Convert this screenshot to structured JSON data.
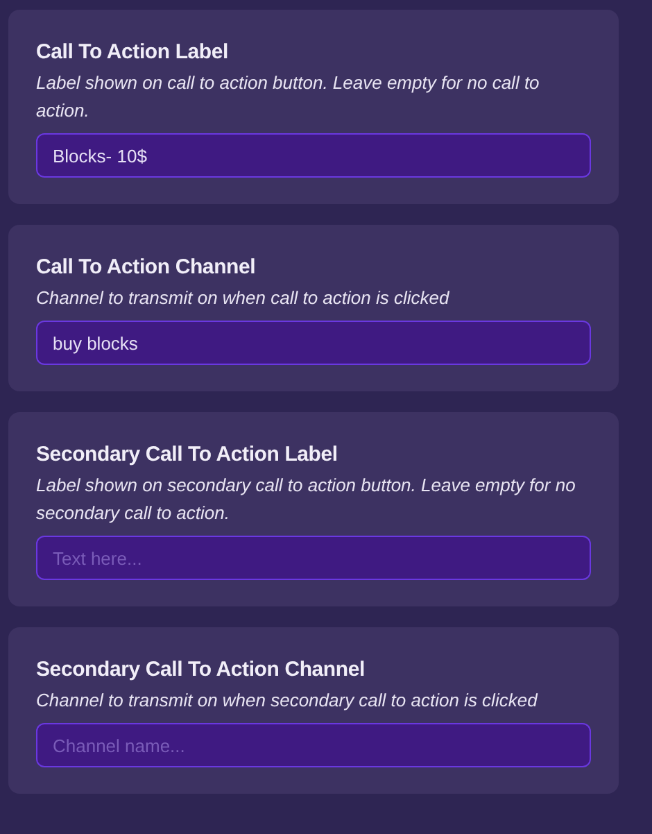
{
  "fields": [
    {
      "title": "Call To Action Label",
      "description": "Label shown on call to action button. Leave empty for no call to action.",
      "value": "Blocks- 10$"
    },
    {
      "title": "Call To Action Channel",
      "description": "Channel to transmit on when call to action is clicked",
      "value": "buy blocks"
    },
    {
      "title": "Secondary Call To Action Label",
      "description": "Label shown on secondary call to action button. Leave empty for no secondary call to action.",
      "placeholder": "Text here..."
    },
    {
      "title": "Secondary Call To Action Channel",
      "description": "Channel to transmit on when secondary call to action is clicked",
      "placeholder": "Channel name..."
    }
  ]
}
